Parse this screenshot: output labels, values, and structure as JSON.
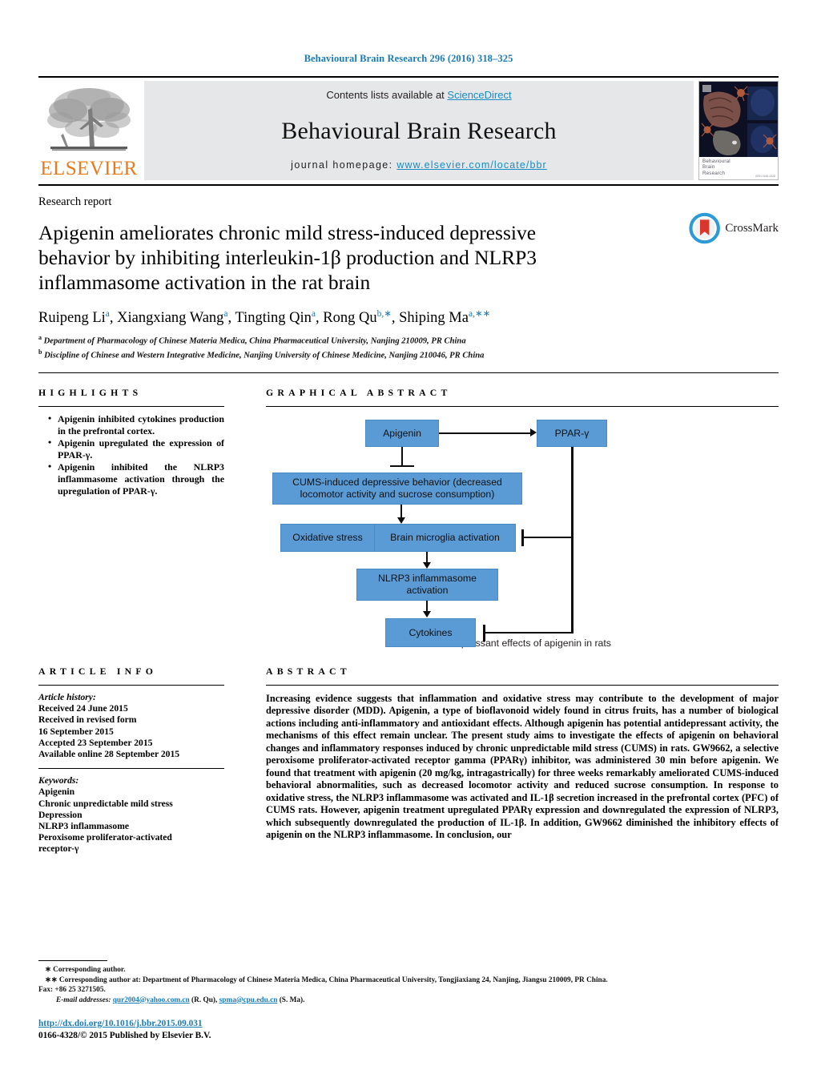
{
  "running_head": "Behavioural Brain Research 296 (2016) 318–325",
  "masthead": {
    "publisher": "ELSEVIER",
    "contents_prefix": "Contents lists available at ",
    "contents_link": "ScienceDirect",
    "journal_title": "Behavioural Brain Research",
    "homepage_prefix": "journal homepage: ",
    "homepage_url": "www.elsevier.com/locate/bbr",
    "cover_line1": "Behavioural",
    "cover_line2": "Brain",
    "cover_line3": "Research",
    "cover_issn": "ISSN 0166-4328"
  },
  "article": {
    "type": "Research report",
    "title": "Apigenin ameliorates chronic mild stress-induced depressive behavior by inhibiting interleukin-1β production and NLRP3 inflammasome activation in the rat brain",
    "authors_html": "Ruipeng Li<sup>a</sup>, Xiangxiang Wang<sup>a</sup>, Tingting Qin<sup>a</sup>, Rong Qu<sup>b,</sup><sup>∗</sup>, Shiping Ma<sup>a,</sup><sup>∗∗</sup>",
    "affiliation_a": "Department of Pharmacology of Chinese Materia Medica, China Pharmaceutical University, Nanjing 210009, PR China",
    "affiliation_b": "Discipline of Chinese and Western Integrative Medicine, Nanjing University of Chinese Medicine, Nanjing 210046, PR China",
    "crossmark_label": "CrossMark"
  },
  "highlights": {
    "heading": "HIGHLIGHTS",
    "items": [
      "Apigenin inhibited cytokines production in the prefrontal cortex.",
      "Apigenin upregulated the expression of PPAR-γ.",
      "Apigenin inhibited the NLRP3 inflammasome activation through the upregulation of PPAR-γ."
    ]
  },
  "graphical_abstract": {
    "heading": "GRAPHICAL ABSTRACT",
    "caption": "Antidepressant effects of apigenin in rats",
    "node_color": "#5b9bd5",
    "nodes": {
      "apigenin": "Apigenin",
      "ppar": "PPAR-γ",
      "cums": "CUMS-induced depressive behavior (decreased locomotor activity and sucrose consumption)",
      "oxidative": "Oxidative stress",
      "microglia": "Brain microglia activation",
      "nlrp3": "NLRP3 inflammasome activation",
      "cytokines": "Cytokines"
    }
  },
  "article_info": {
    "heading": "ARTICLE INFO",
    "history_label": "Article history:",
    "history": [
      "Received 24 June 2015",
      "Received in revised form",
      "16 September 2015",
      "Accepted 23 September 2015",
      "Available online 28 September 2015"
    ],
    "keywords_label": "Keywords:",
    "keywords": [
      "Apigenin",
      "Chronic unpredictable mild stress",
      "Depression",
      "NLRP3 inflammasome",
      "Peroxisome proliferator-activated",
      "receptor-γ"
    ]
  },
  "abstract": {
    "heading": "ABSTRACT",
    "text": "Increasing evidence suggests that inflammation and oxidative stress may contribute to the development of major depressive disorder (MDD). Apigenin, a type of bioflavonoid widely found in citrus fruits, has a number of biological actions including anti-inflammatory and antioxidant effects. Although apigenin has potential antidepressant activity, the mechanisms of this effect remain unclear. The present study aims to investigate the effects of apigenin on behavioral changes and inflammatory responses induced by chronic unpredictable mild stress (CUMS) in rats. GW9662, a selective peroxisome proliferator-activated receptor gamma (PPARγ) inhibitor, was administered 30 min before apigenin. We found that treatment with apigenin (20 mg/kg, intragastrically) for three weeks remarkably ameliorated CUMS-induced behavioral abnormalities, such as decreased locomotor activity and reduced sucrose consumption. In response to oxidative stress, the NLRP3 inflammasome was activated and IL-1β secretion increased in the prefrontal cortex (PFC) of CUMS rats. However, apigenin treatment upregulated PPARγ expression and downregulated the expression of NLRP3, which subsequently downregulated the production of IL-1β. In addition, GW9662 diminished the inhibitory effects of apigenin on the NLRP3 inflammasome. In conclusion, our"
  },
  "footnotes": {
    "line1": "∗ Corresponding author.",
    "line2": "∗∗ Corresponding author at: Department of Pharmacology of Chinese Materia Medica, China Pharmaceutical University, Tongjiaxiang 24, Nanjing, Jiangsu 210009, PR China.",
    "line3": "Fax: +86 25 3271505.",
    "email_label": "E-mail addresses:",
    "email1": "qur2004@yahoo.com.cn",
    "email1_who": "(R. Qu),",
    "email2": "spma@cpu.edu.cn",
    "email2_who": "(S. Ma)."
  },
  "bottom": {
    "doi": "http://dx.doi.org/10.1016/j.bbr.2015.09.031",
    "copyright": "0166-4328/© 2015 Published by Elsevier B.V."
  }
}
